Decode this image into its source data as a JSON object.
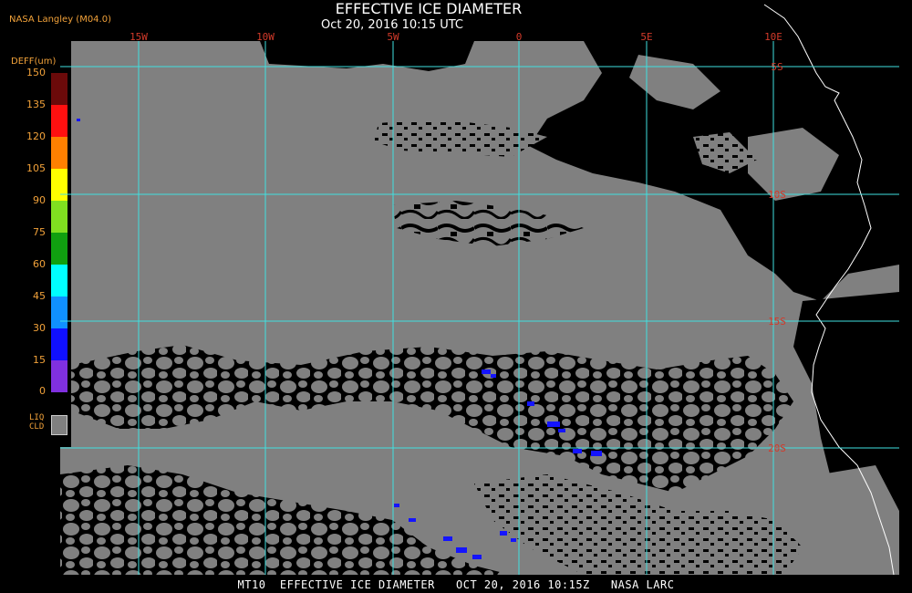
{
  "header": {
    "title": "EFFECTIVE ICE DIAMETER",
    "subtitle": "Oct 20, 2016 10:15 UTC",
    "source": "NASA Langley (M04.0)"
  },
  "legend": {
    "title": "DEFF(um)",
    "ticks": [
      "150",
      "135",
      "120",
      "105",
      "90",
      "75",
      "60",
      "45",
      "30",
      "15",
      "0"
    ],
    "colors": [
      "#6b0a0a",
      "#ff1010",
      "#ff8000",
      "#ffff00",
      "#80e020",
      "#10a010",
      "#00ffff",
      "#1090ff",
      "#1010ff",
      "#8030e0"
    ],
    "liquid_label_1": "LIQ",
    "liquid_label_2": "CLD",
    "liquid_color": "#808080"
  },
  "grid": {
    "lon_labels": [
      "15W",
      "10W",
      "5W",
      "0",
      "5E",
      "10E"
    ],
    "lat_labels": [
      "5S",
      "10S",
      "15S",
      "20S"
    ],
    "line_color": "#40e0e0"
  },
  "footer": {
    "text": "MT10  EFFECTIVE ICE DIAMETER   OCT 20, 2016 10:15Z   NASA LARC"
  }
}
